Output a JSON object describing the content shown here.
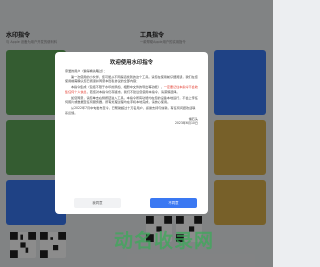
{
  "background": {
    "left_section": {
      "title": "水印指令",
      "subtitle": "与 Apple 设备为用户开发的便利科"
    },
    "right_section": {
      "title": "工具指令",
      "subtitle": "一款帮助Apple用户的实用指令"
    }
  },
  "modal": {
    "title": "欢迎使用水印指令",
    "greeting": "亲爱的用户（懒得看先略过）：",
    "p1_a": "第一次使用的小伙伴，您可能从不同渠道找到的这个工具。请您在使用前仔细阅读，我们在您使用前需确认您已阅读并同意本隐私协议的全部内容：",
    "p2_a": "本指令集成（包括不限于水印的添加、相册中文件的导出等功能），",
    "p2_hl": "一定要记住本指令不会收集任何个人信息",
    "p2_b": "，若您对本指令仍存疑虑，我们不建议您使用本指令，请谨慎选择。",
    "p3": "如您同意，请您单击右侧按钮进入工具。本指令所有功能均在您的设备本地运行，不会上传任何照片或数据至任何服务器，所有处理过程均在手机本地完成，请放心使用。",
    "p4": "从2022年7月中旬发布至今，已帮助超过十万名用户，感谢支持与信赖，有任何问题欢迎联系反馈。",
    "sig_name": "懒石头",
    "sig_date": "2023年6月10日",
    "agree_label": "我同意",
    "reject_label": "不同意"
  },
  "watermark_text": "动名收录网",
  "colors": {
    "accent": "#3a78f2",
    "highlight": "#e23b2e",
    "card_green": "#5fa85a",
    "card_blue": "#3a78f2",
    "card_gold": "#d9b04b"
  }
}
